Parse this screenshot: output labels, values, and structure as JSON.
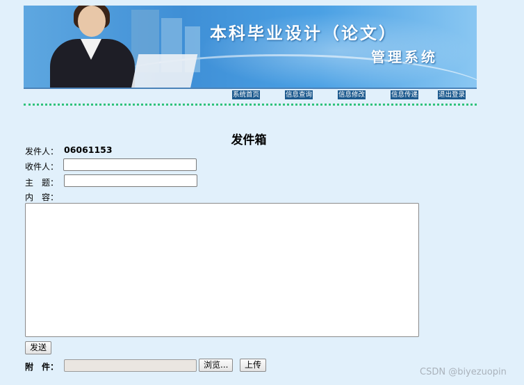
{
  "banner": {
    "title_line1": "本科毕业设计（论文）",
    "title_line2": "管理系统"
  },
  "nav": {
    "items": [
      {
        "label": "系统首页"
      },
      {
        "label": "信息查询"
      },
      {
        "label": "信息修改"
      },
      {
        "label": "信息传递"
      },
      {
        "label": "退出登录"
      }
    ]
  },
  "page": {
    "heading": "发件箱"
  },
  "form": {
    "sender_label": "发件人：",
    "sender_value": "06061153",
    "recipient_label": "收件人：",
    "recipient_value": "",
    "subject_label": "主　题：",
    "subject_value": "",
    "content_label": "内　容：",
    "content_value": "",
    "send_label": "发送",
    "attachment_label": "附　件：",
    "browse_label": "浏览...",
    "upload_label": "上传"
  },
  "watermark": {
    "text": "CSDN @biyezuopin"
  }
}
